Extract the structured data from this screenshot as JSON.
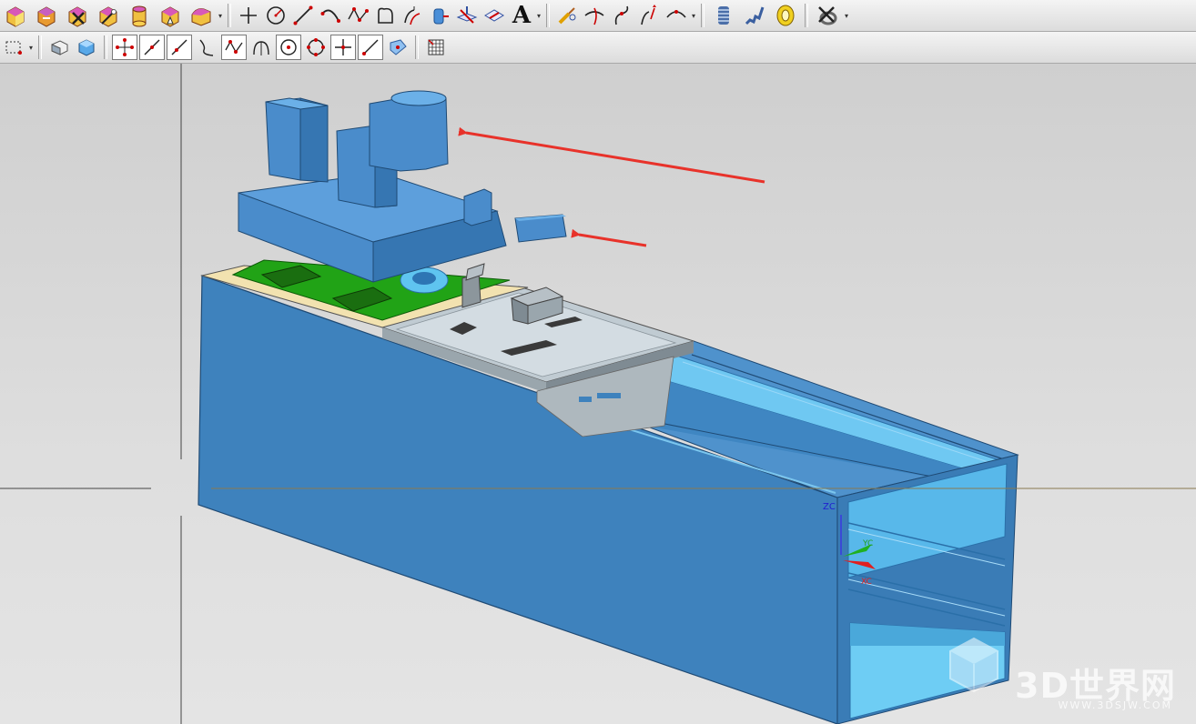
{
  "toolbar_row1": {
    "groups": [
      [
        "feature-block-icon",
        "feature-extrude-icon",
        "feature-delete-icon",
        "feature-magic-icon",
        "feature-cylinder-icon",
        "feature-cone-icon",
        "feature-edge-blend-icon"
      ],
      [
        "point-icon",
        "circle-icon",
        "line-icon",
        "arc-icon",
        "spline-points-icon",
        "curve-shape-icon",
        "offset-curve-icon",
        "project-curve-icon",
        "intersection-curve-icon",
        "isoparametric-icon",
        "text-icon"
      ],
      [
        "edit-curve-icon",
        "trim-curve-icon",
        "curve-blend-icon",
        "extend-curve-icon",
        "bridge-curve-icon"
      ],
      [
        "helix-icon",
        "spring-icon",
        "coil-icon"
      ],
      [
        "delete-object-icon"
      ]
    ],
    "text_glyph": "A"
  },
  "toolbar_row2": {
    "items": [
      "select-box-icon",
      "snap-face-icon",
      "snap-cube-icon",
      "snap-control-points-icon",
      "snap-line-icon",
      "snap-diagonal-icon",
      "snap-curve-icon",
      "snap-spline-icon",
      "snap-arc-icon",
      "snap-center-icon",
      "snap-quadrant-icon",
      "snap-intersection-icon",
      "snap-tangent-icon",
      "snap-surface-icon",
      "grid-icon"
    ]
  },
  "viewport": {
    "triad": {
      "zc_label": "ZC",
      "yc_label": "YC",
      "xc_label": "XC"
    },
    "watermark": {
      "text": "3D世界网",
      "url": "WWW.3DSJW.COM"
    },
    "colors": {
      "body": "#3e82bd",
      "body_dark": "#2f6fa8",
      "inner": "#5fc4f0",
      "pcb": "#21a316",
      "plate": "#c0cbd2",
      "cover": "#5d9fdc",
      "arrow": "#e8322a"
    }
  }
}
